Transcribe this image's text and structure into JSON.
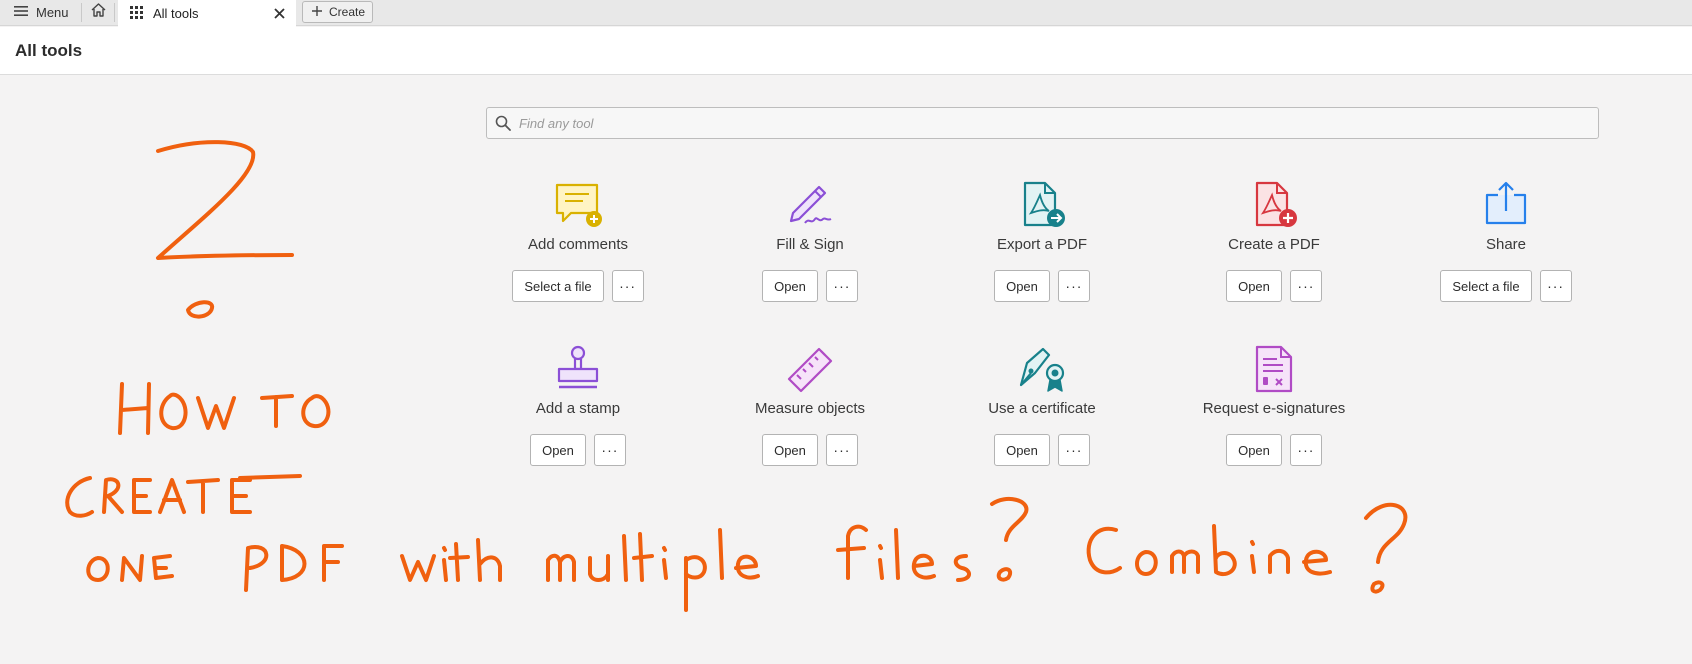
{
  "tabbar": {
    "menu_label": "Menu",
    "tab_label": "All tools",
    "create_label": "Create"
  },
  "header": {
    "title": "All tools"
  },
  "search": {
    "placeholder": "Find any tool"
  },
  "tools": [
    {
      "name": "Add comments",
      "primary": "Select a file",
      "more": "···",
      "icon": "comment-add-icon",
      "color": "#d9b100"
    },
    {
      "name": "Fill & Sign",
      "primary": "Open",
      "more": "···",
      "icon": "pen-sign-icon",
      "color": "#8b4fd6"
    },
    {
      "name": "Export a PDF",
      "primary": "Open",
      "more": "···",
      "icon": "pdf-export-icon",
      "color": "#18818b"
    },
    {
      "name": "Create a PDF",
      "primary": "Open",
      "more": "···",
      "icon": "pdf-create-icon",
      "color": "#d7373f"
    },
    {
      "name": "Share",
      "primary": "Select a file",
      "more": "···",
      "icon": "share-icon",
      "color": "#2680eb"
    },
    {
      "name": "Add a stamp",
      "primary": "Open",
      "more": "···",
      "icon": "stamp-icon",
      "color": "#8b4fd6"
    },
    {
      "name": "Measure objects",
      "primary": "Open",
      "more": "···",
      "icon": "ruler-icon",
      "color": "#b04bc5"
    },
    {
      "name": "Use a certificate",
      "primary": "Open",
      "more": "···",
      "icon": "certificate-pen-icon",
      "color": "#18818b"
    },
    {
      "name": "Request e-signatures",
      "primary": "Open",
      "more": "···",
      "icon": "esign-request-icon",
      "color": "#b04bc5"
    }
  ],
  "annotation": {
    "handwritten_text": "? HOW TO CREATE ONE PDF with multiple files? Combine ?",
    "color": "#f0600f"
  }
}
